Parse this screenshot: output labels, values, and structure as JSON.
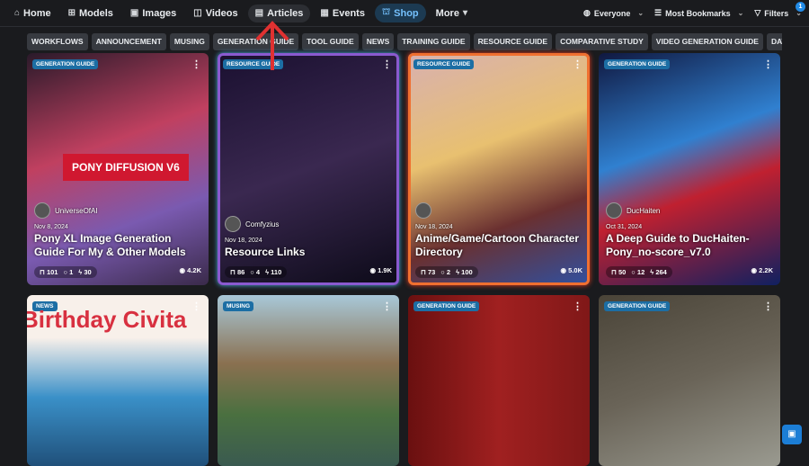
{
  "nav": {
    "items": [
      {
        "label": "Home",
        "icon": "home-icon"
      },
      {
        "label": "Models",
        "icon": "grid-icon"
      },
      {
        "label": "Images",
        "icon": "image-icon"
      },
      {
        "label": "Videos",
        "icon": "video-icon"
      },
      {
        "label": "Articles",
        "icon": "document-icon"
      },
      {
        "label": "Events",
        "icon": "calendar-icon"
      },
      {
        "label": "Shop",
        "icon": "shop-icon"
      },
      {
        "label": "More"
      }
    ],
    "active": "Articles"
  },
  "controls": {
    "audience": "Everyone",
    "sort": "Most Bookmarks",
    "filters": "Filters",
    "filter_count": "1"
  },
  "tags": [
    "WORKFLOWS",
    "ANNOUNCEMENT",
    "MUSING",
    "GENERATION GUIDE",
    "TOOL GUIDE",
    "NEWS",
    "TRAINING GUIDE",
    "RESOURCE GUIDE",
    "COMPARATIVE STUDY",
    "VIDEO GENERATION GUIDE",
    "DATA"
  ],
  "cards": [
    {
      "category": "GENERATION GUIDE",
      "author": "UniverseOfAI",
      "date": "Nov 8, 2024",
      "title": "Pony XL Image Generation Guide For My & Other Models",
      "bookmarks": "101",
      "comments": "1",
      "tips": "30",
      "views": "4.2K",
      "image_text": "PONY DIFFUSION V6"
    },
    {
      "category": "RESOURCE GUIDE",
      "author": "Comfyzius",
      "date": "Nov 18, 2024",
      "title": "Resource Links",
      "bookmarks": "86",
      "comments": "4",
      "tips": "110",
      "views": "1.9K"
    },
    {
      "category": "RESOURCE GUIDE",
      "author": "",
      "date": "Nov 18, 2024",
      "title": "Anime/Game/Cartoon Character Directory",
      "bookmarks": "73",
      "comments": "2",
      "tips": "100",
      "views": "5.0K"
    },
    {
      "category": "GENERATION GUIDE",
      "author": "DucHaiten",
      "date": "Oct 31, 2024",
      "title": "A Deep Guide to DucHaiten-Pony_no-score_v7.0",
      "bookmarks": "50",
      "comments": "12",
      "tips": "264",
      "views": "2.2K"
    },
    {
      "category": "NEWS",
      "image_text": "Birthday Civita"
    },
    {
      "category": "MUSING"
    },
    {
      "category": "GENERATION GUIDE"
    },
    {
      "category": "GENERATION GUIDE"
    }
  ],
  "colors": {
    "accent": "#228be6",
    "category_badge": "#1c6ea4",
    "annotation_arrow": "#e03131"
  }
}
